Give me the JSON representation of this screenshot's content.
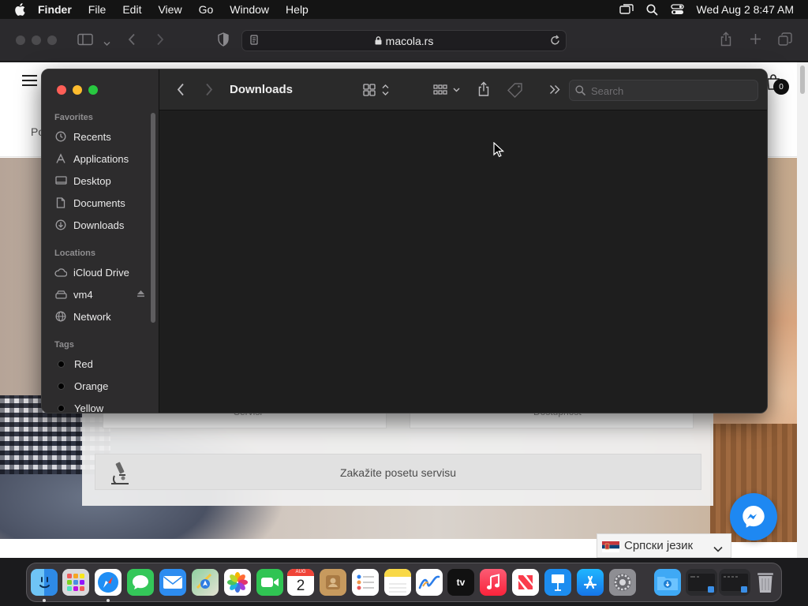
{
  "menubar": {
    "app_name": "Finder",
    "items": [
      "File",
      "Edit",
      "View",
      "Go",
      "Window",
      "Help"
    ],
    "datetime": "Wed Aug 2  8:47 AM"
  },
  "safari": {
    "url_host": "macola.rs"
  },
  "webpage": {
    "header_partial_text": "Po",
    "cart_count": "0",
    "card_left_label": "Servisi",
    "card_right_label": "Dostupnost",
    "cta_label": "Zakažite posetu servisu",
    "language_label": "Српски језик"
  },
  "finder": {
    "title": "Downloads",
    "search_placeholder": "Search",
    "sidebar": {
      "favorites_heading": "Favorites",
      "favorites": [
        {
          "label": "Recents",
          "icon": "clock-icon"
        },
        {
          "label": "Applications",
          "icon": "applications-icon"
        },
        {
          "label": "Desktop",
          "icon": "desktop-icon"
        },
        {
          "label": "Documents",
          "icon": "document-icon"
        },
        {
          "label": "Downloads",
          "icon": "download-icon"
        }
      ],
      "locations_heading": "Locations",
      "locations": [
        {
          "label": "iCloud Drive",
          "icon": "cloud-icon"
        },
        {
          "label": "vm4",
          "icon": "drive-icon"
        },
        {
          "label": "Network",
          "icon": "globe-icon"
        }
      ],
      "tags_heading": "Tags",
      "tags": [
        {
          "label": "Red"
        },
        {
          "label": "Orange"
        },
        {
          "label": "Yellow"
        }
      ]
    }
  },
  "dock": {
    "apps": [
      "Finder",
      "Launchpad",
      "Safari",
      "Messages",
      "Mail",
      "Maps",
      "Photos",
      "FaceTime",
      "Calendar",
      "Contacts",
      "Reminders",
      "Notes",
      "Freeform",
      "TV",
      "Music",
      "News",
      "Keynote",
      "App Store",
      "System Settings",
      "Downloads",
      "Window 1",
      "Window 2",
      "Trash"
    ],
    "calendar_month": "AUG",
    "calendar_day": "2",
    "tv_label": "tv"
  }
}
